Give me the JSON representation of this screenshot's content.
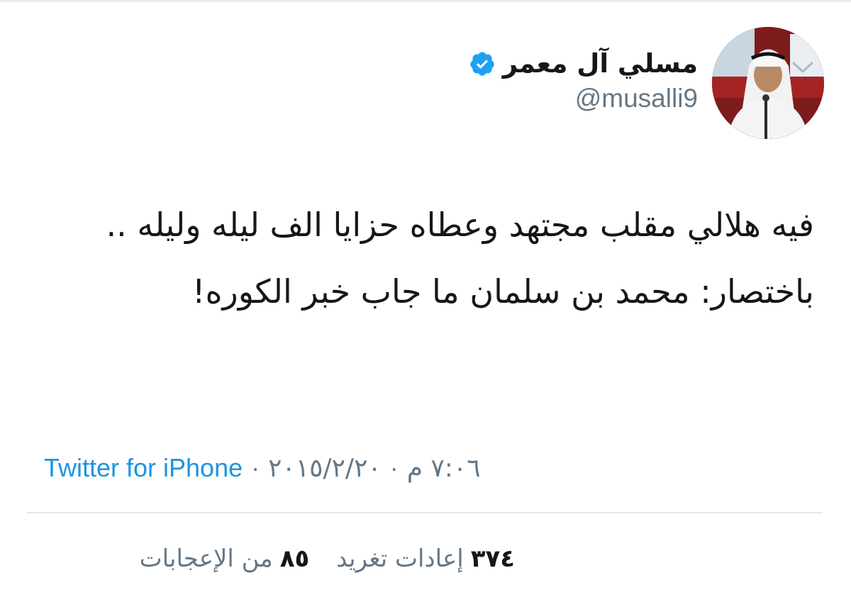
{
  "user": {
    "display_name": "مسلي آل معمر",
    "handle": "@musalli9",
    "verified": true
  },
  "icons": {
    "verified": "verified-badge-icon",
    "more": "chevron-down-icon"
  },
  "tweet": {
    "line1": "فيه هلالي مقلب مجتهد وعطاه حزايا الف ليله وليله ..",
    "line2": "باختصار: محمد بن سلمان ما جاب خبر الكوره!"
  },
  "meta": {
    "time": "٧:٠٦ م",
    "date": "٢٠١٥/٢/٢٠",
    "separator": "·",
    "source": "Twitter for iPhone"
  },
  "stats": {
    "retweets_count": "٣٧٤",
    "retweets_label": "إعادات تغريد",
    "likes_count": "٨٥",
    "likes_label": "من الإعجابات"
  },
  "colors": {
    "link": "#1b95e0",
    "secondary_text": "#657786",
    "primary_text": "#14171a",
    "verified": "#1da1f2"
  }
}
